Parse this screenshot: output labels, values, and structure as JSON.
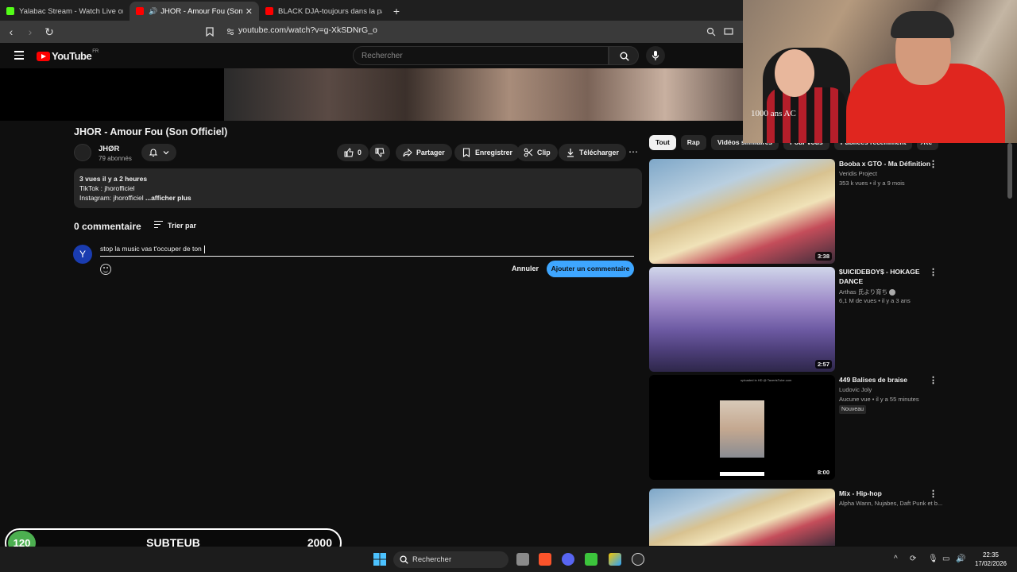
{
  "browser": {
    "tabs": [
      {
        "title": "Yalabac Stream - Watch Live on Kick",
        "color": "#53fc18"
      },
      {
        "title": "JHOR - Amour Fou (Son Offi",
        "color": "#ff0000"
      },
      {
        "title": "BLACK DJA-toujours dans la partie-C",
        "color": "#ff0000"
      }
    ],
    "url": "youtube.com/watch?v=g-XkSDNrG_o"
  },
  "youtube": {
    "logo_text": "YouTube",
    "region": "FR",
    "search_placeholder": "Rechercher"
  },
  "video": {
    "title": "JHOR - Amour Fou (Son Officiel)",
    "channel": "JHØR",
    "subscribers": "79 abonnés",
    "likes": "0",
    "actions": {
      "share": "Partager",
      "save": "Enregistrer",
      "clip": "Clip",
      "download": "Télécharger"
    },
    "description": {
      "line1": "3 vues  il y a 2 heures",
      "line2": "TikTok : jhorofficiel",
      "line3": "Instagram: jhorofficiel ",
      "more": "...afficher plus"
    }
  },
  "comments": {
    "count": "0 commentaire",
    "sort": "Trier par",
    "avatar_letter": "Y",
    "draft": "stop la music vas t'occuper de ton ",
    "cancel": "Annuler",
    "submit": "Ajouter un commentaire"
  },
  "chips": [
    "Tout",
    "Rap",
    "Vidéos similaires",
    "Pour vous",
    "Publiées récemment",
    "Re"
  ],
  "recommendations": [
    {
      "title": "Booba x GTO - Ma Définition",
      "channel": "Veridis Project",
      "meta": "353 k vues • il y a 9 mois",
      "duration": "3:38"
    },
    {
      "title": "$UICIDEBOY$ - HOKAGE DANCE",
      "channel": "Arthas 氏より育ち",
      "meta": "6,1 M de vues • il y a 3 ans",
      "duration": "2:57"
    },
    {
      "title": "449 Balises de braise",
      "channel": "Ludovic Joly",
      "meta": "Aucune vue • il y a 55 minutes",
      "badge": "Nouveau",
      "duration": "8:00",
      "thumb_caption": "uploaded in HD @ TavertsTube.com"
    },
    {
      "title": "Mix - Hip-hop",
      "channel": "Alpha Wann, Nujabes, Daft Punk et b..."
    }
  ],
  "webcam": {
    "shirt_text": "1000 ans AC"
  },
  "subgoal": {
    "current": "120",
    "label": "SUBTEUB",
    "goal": "2000"
  },
  "taskbar": {
    "search": "Rechercher",
    "time": "22:35",
    "date": "17/02/2026"
  }
}
